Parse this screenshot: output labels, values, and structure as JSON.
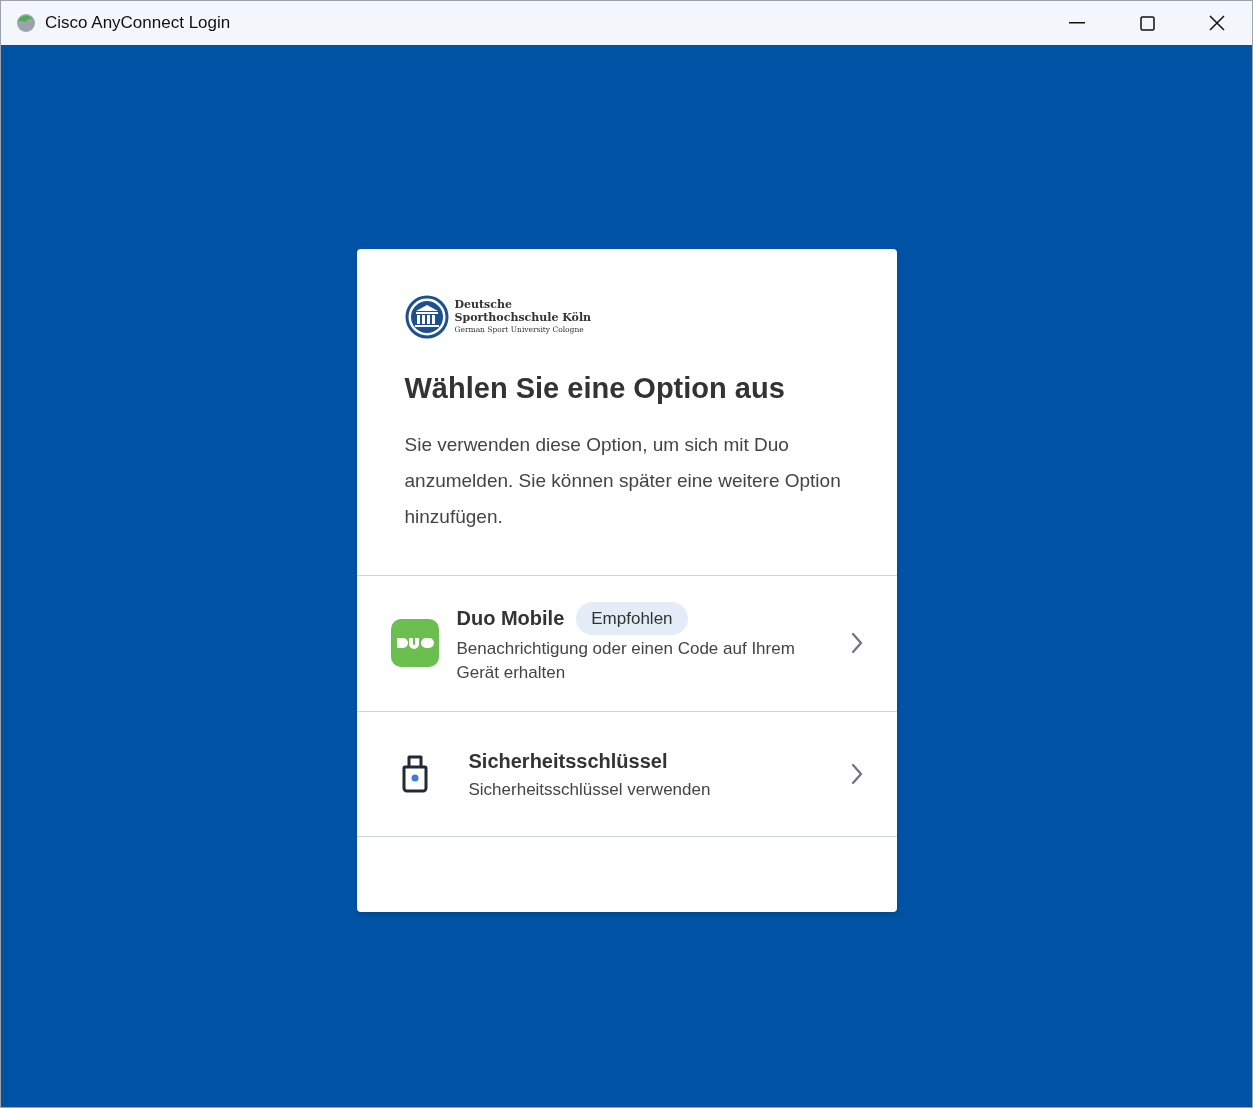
{
  "window": {
    "title": "Cisco AnyConnect Login"
  },
  "logo": {
    "name_lines": [
      "Deutsche",
      "Sporthochschule Köln"
    ],
    "subtitle": "German Sport University Cologne"
  },
  "heading": "Wählen Sie eine Option aus",
  "description": "Sie verwenden diese Option, um sich mit Duo anzumelden. Sie können später eine weitere Option hinzufügen.",
  "options": [
    {
      "kind": "duo",
      "title": "Duo Mobile",
      "badge": "Empfohlen",
      "subtitle": "Benachrichtigung oder einen Code auf Ihrem Gerät erhalten"
    },
    {
      "kind": "key",
      "title": "Sicherheitsschlüssel",
      "subtitle": "Sicherheitsschlüssel verwenden"
    }
  ]
}
